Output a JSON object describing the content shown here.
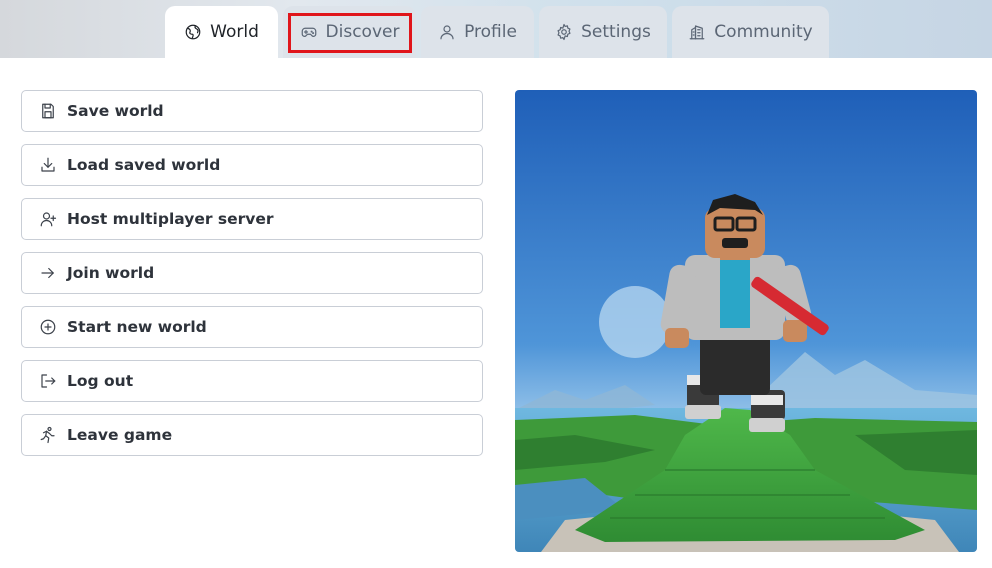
{
  "tabs": [
    {
      "label": "World",
      "icon": "globe-icon",
      "active": true
    },
    {
      "label": "Discover",
      "icon": "gamepad-icon",
      "active": false
    },
    {
      "label": "Profile",
      "icon": "user-icon",
      "active": false
    },
    {
      "label": "Settings",
      "icon": "gear-icon",
      "active": false
    },
    {
      "label": "Community",
      "icon": "building-icon",
      "active": false
    }
  ],
  "menu": [
    {
      "label": "Save world",
      "icon": "save-icon"
    },
    {
      "label": "Load saved world",
      "icon": "download-icon"
    },
    {
      "label": "Host multiplayer server",
      "icon": "user-plus-icon"
    },
    {
      "label": "Join world",
      "icon": "arrow-right-icon"
    },
    {
      "label": "Start new world",
      "icon": "plus-circle-icon"
    },
    {
      "label": "Log out",
      "icon": "logout-icon"
    },
    {
      "label": "Leave game",
      "icon": "running-person-icon"
    }
  ],
  "hero": {
    "description_icon": "avatar-on-hill-image"
  },
  "colors": {
    "highlight": "#e0151b",
    "tab_active_bg": "#ffffff",
    "tab_inactive_bg": "#dde3ea",
    "button_border": "#c9ced6"
  }
}
